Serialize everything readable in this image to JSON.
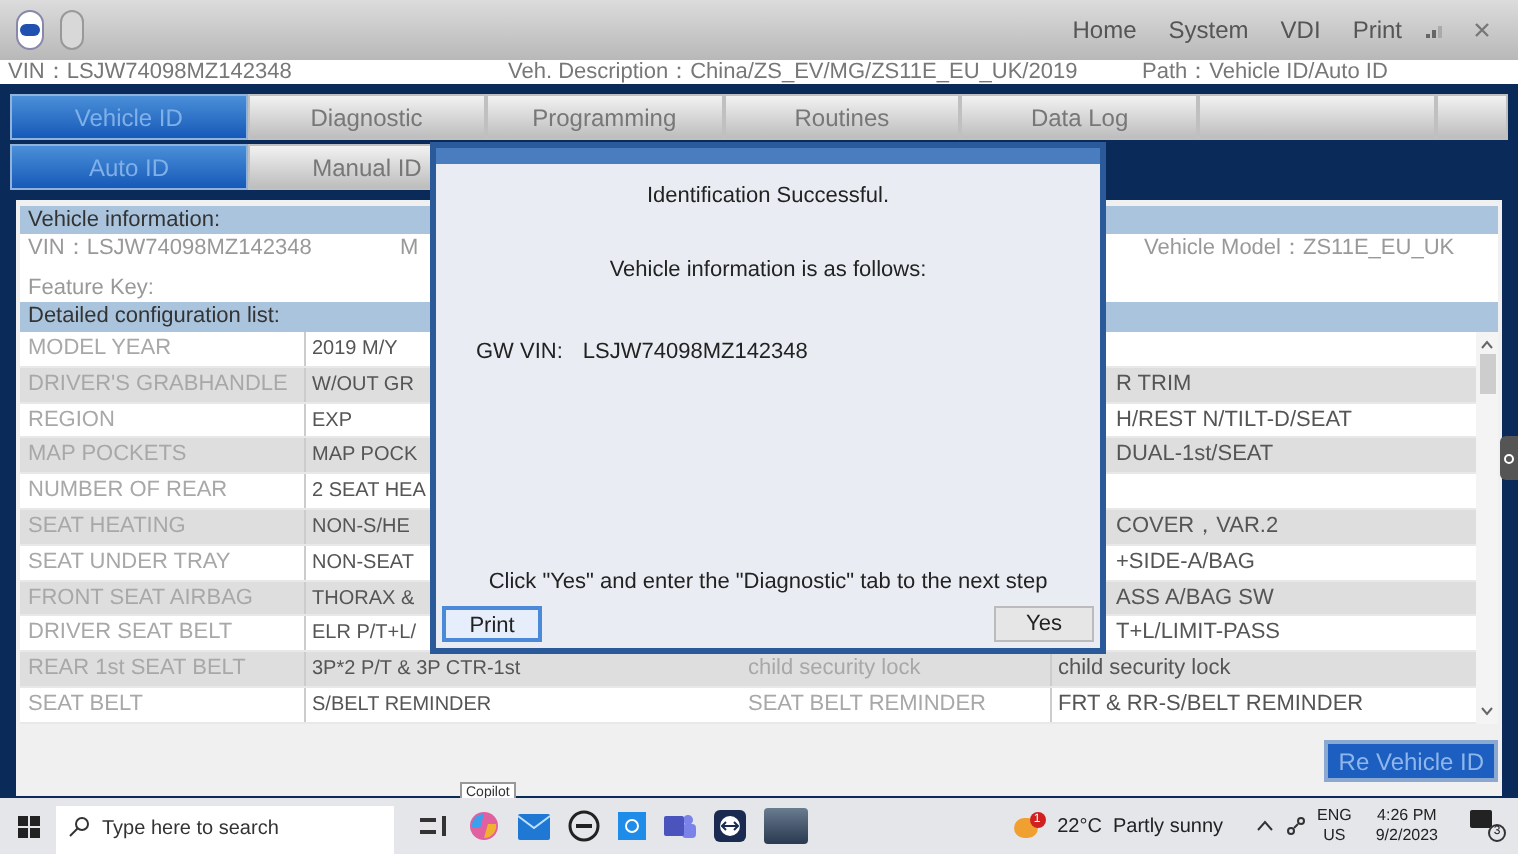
{
  "menu": [
    "Home",
    "System",
    "VDI",
    "Print"
  ],
  "info_bar": {
    "vin": "VIN：LSJW74098MZ142348",
    "description": "Veh. Description：China/ZS_EV/MG/ZS11E_EU_UK/2019",
    "path": "Path：Vehicle ID/Auto ID"
  },
  "tabs": [
    {
      "label": "Vehicle ID",
      "selected": true
    },
    {
      "label": "Diagnostic",
      "selected": false
    },
    {
      "label": "Programming",
      "selected": false
    },
    {
      "label": "Routines",
      "selected": false
    },
    {
      "label": "Data Log",
      "selected": false
    },
    {
      "selected": false
    },
    {
      "selected": false
    }
  ],
  "subtabs": [
    {
      "label": "Auto ID",
      "selected": true
    },
    {
      "label": "Manual ID",
      "selected": false
    }
  ],
  "vehicle_information": {
    "title": "Vehicle information:",
    "vin": "VIN：LSJW74098MZ142348",
    "model_cut": "M",
    "model": "Vehicle Model：ZS11E_EU_UK",
    "feature_key": "Feature Key:"
  },
  "config": {
    "title": "Detailed configuration list:",
    "rows": [
      {
        "label": "MODEL YEAR",
        "value": "2019 M/Y"
      },
      {
        "label": "DRIVER'S GRABHANDLE",
        "value": "W/OUT GR",
        "value2": "R TRIM",
        "clipped": true
      },
      {
        "label": "REGION",
        "value": "EXP",
        "value2": "H/REST N/TILT-D/SEAT",
        "clipped": true
      },
      {
        "label": "MAP POCKETS",
        "value": "MAP POCK",
        "value2": "DUAL-1st/SEAT",
        "clipped": true
      },
      {
        "label": "NUMBER OF REAR",
        "value": "2 SEAT HEA"
      },
      {
        "label": "SEAT HEATING",
        "value": "NON-S/HE",
        "value2": "COVER，VAR.2",
        "clipped": true
      },
      {
        "label": "SEAT UNDER TRAY",
        "value": "NON-SEAT",
        "value2": "+SIDE-A/BAG",
        "clipped": true
      },
      {
        "label": "FRONT SEAT AIRBAG",
        "value": "THORAX &",
        "value2": "ASS A/BAG SW",
        "clipped": true
      },
      {
        "label": "DRIVER SEAT BELT",
        "value": "ELR P/T+L/",
        "value2": "T+L/LIMIT-PASS",
        "clipped": true
      },
      {
        "label": "REAR 1st SEAT BELT",
        "value": "3P*2 P/T & 3P CTR-1st",
        "label2": "child security lock",
        "value2": "child security lock",
        "clipped": false
      },
      {
        "label": "SEAT BELT",
        "value": "S/BELT REMINDER",
        "label2": "SEAT BELT REMINDER",
        "value2": "FRT & RR-S/BELT REMINDER",
        "clipped": false
      }
    ]
  },
  "re_vehicle_button": "Re Vehicle ID",
  "dialog": {
    "heading": "Identification Successful.",
    "subheading": "Vehicle information is as follows:",
    "gw_vin_label": "GW VIN:",
    "gw_vin": "LSJW74098MZ142348",
    "instruction": "Click \"Yes\" and enter the \"Diagnostic\" tab to the next step",
    "buttons": [
      {
        "label": "Print",
        "selected": true
      },
      {
        "label": "Yes",
        "selected": false
      }
    ]
  },
  "taskbar": {
    "search_placeholder": "Type here to search",
    "tooltip": "Copilot",
    "weather_badge": "1",
    "weather": "22°C  Partly sunny",
    "language": "ENG",
    "region": "US",
    "time": "4:26 PM",
    "date": "9/2/2023",
    "notifications": "3"
  }
}
